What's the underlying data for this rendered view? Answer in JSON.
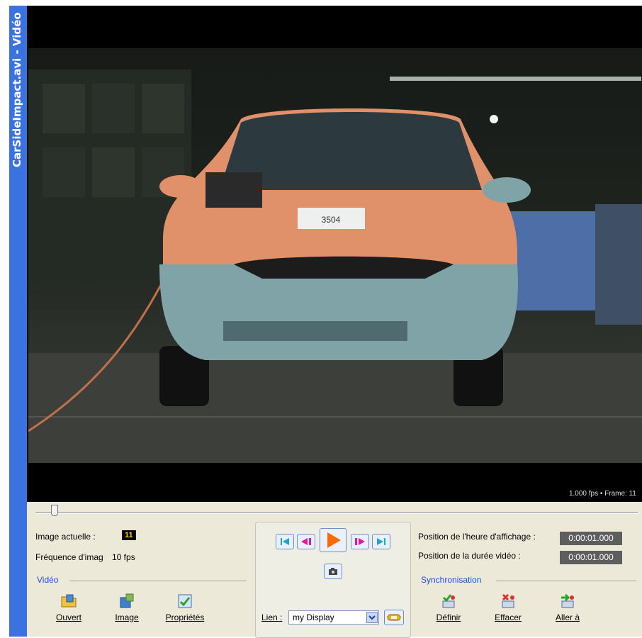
{
  "window": {
    "title": "CarSideImpact.avi - Vidéo"
  },
  "video": {
    "overlay": "1.000 fps  •  Frame: 11",
    "plate_text": "3504",
    "position": 0.02
  },
  "left": {
    "current_image_label": "Image actuelle :",
    "current_image_value": "11",
    "frequency_label": "Fréquence d'imag",
    "frequency_value": "10 fps",
    "group_title": "Vidéo",
    "tools": [
      {
        "label": "Ouvert",
        "icon": "open-folder-icon"
      },
      {
        "label": "Image",
        "icon": "image-export-icon"
      },
      {
        "label": "Propriétés",
        "icon": "properties-icon"
      }
    ]
  },
  "center": {
    "link_label": "Lien :",
    "link_value": "my Display",
    "buttons": [
      "first-frame",
      "previous-frame",
      "play",
      "next-frame",
      "last-frame",
      "snapshot",
      "link"
    ]
  },
  "right": {
    "display_time_label": "Position de l'heure d'affichage :",
    "display_time_value": "0:00:01.000",
    "video_duration_label": "Position de la durée vidéo :",
    "video_duration_value": "0:00:01.000",
    "group_title": "Synchronisation",
    "tools": [
      {
        "label": "Définir",
        "icon": "define-sync-icon"
      },
      {
        "label": "Effacer",
        "icon": "clear-sync-icon"
      },
      {
        "label": "Aller à",
        "icon": "goto-sync-icon"
      }
    ]
  },
  "colors": {
    "accent": "#3a73e0",
    "play": "#ff6a00",
    "group_title": "#1f4fd1",
    "badge": "#ffd400"
  }
}
